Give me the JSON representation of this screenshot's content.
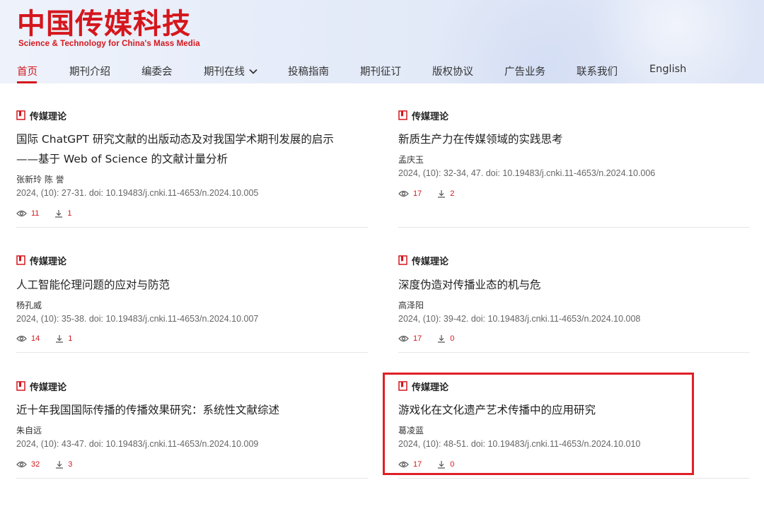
{
  "brand": {
    "name_cn": "中国传媒科技",
    "name_en": "Science & Technology for China's Mass Media",
    "color": "#d4171d"
  },
  "nav": {
    "items": [
      {
        "label": "首页",
        "active": true
      },
      {
        "label": "期刊介绍"
      },
      {
        "label": "编委会"
      },
      {
        "label": "期刊在线",
        "dropdown": true
      },
      {
        "label": "投稿指南"
      },
      {
        "label": "期刊征订"
      },
      {
        "label": "版权协议"
      },
      {
        "label": "广告业务"
      },
      {
        "label": "联系我们"
      },
      {
        "label": "English"
      }
    ]
  },
  "articles": [
    {
      "category": "传媒理论",
      "title_lines": [
        "国际 ChatGPT 研究文献的出版动态及对我国学术期刊发展的启示",
        "——基于 Web of Science 的文献计量分析"
      ],
      "authors": "张新玲 陈 誉",
      "citation": "2024, (10): 27-31.   doi: 10.19483/j.cnki.11-4653/n.2024.10.005",
      "views": "11",
      "downloads": "1"
    },
    {
      "category": "传媒理论",
      "title_lines": [
        "新质生产力在传媒领域的实践思考"
      ],
      "authors": "孟庆玉",
      "citation": "2024, (10): 32-34,  47.   doi: 10.19483/j.cnki.11-4653/n.2024.10.006",
      "views": "17",
      "downloads": "2"
    },
    {
      "category": "传媒理论",
      "title_lines": [
        "人工智能伦理问题的应对与防范"
      ],
      "authors": "杨孔威",
      "citation": "2024, (10): 35-38.   doi: 10.19483/j.cnki.11-4653/n.2024.10.007",
      "views": "14",
      "downloads": "1"
    },
    {
      "category": "传媒理论",
      "title_lines": [
        "深度伪造对传播业态的机与危"
      ],
      "authors": "高泽阳",
      "citation": "2024, (10): 39-42.   doi: 10.19483/j.cnki.11-4653/n.2024.10.008",
      "views": "17",
      "downloads": "0"
    },
    {
      "category": "传媒理论",
      "title_lines": [
        "近十年我国国际传播的传播效果研究：系统性文献综述"
      ],
      "authors": "朱自远",
      "citation": "2024, (10): 43-47.   doi: 10.19483/j.cnki.11-4653/n.2024.10.009",
      "views": "32",
      "downloads": "3"
    },
    {
      "category": "传媒理论",
      "title_lines": [
        "游戏化在文化遗产艺术传播中的应用研究"
      ],
      "authors": "葛凌蓝",
      "citation": "2024, (10): 48-51.   doi: 10.19483/j.cnki.11-4653/n.2024.10.010",
      "views": "17",
      "downloads": "0"
    }
  ]
}
